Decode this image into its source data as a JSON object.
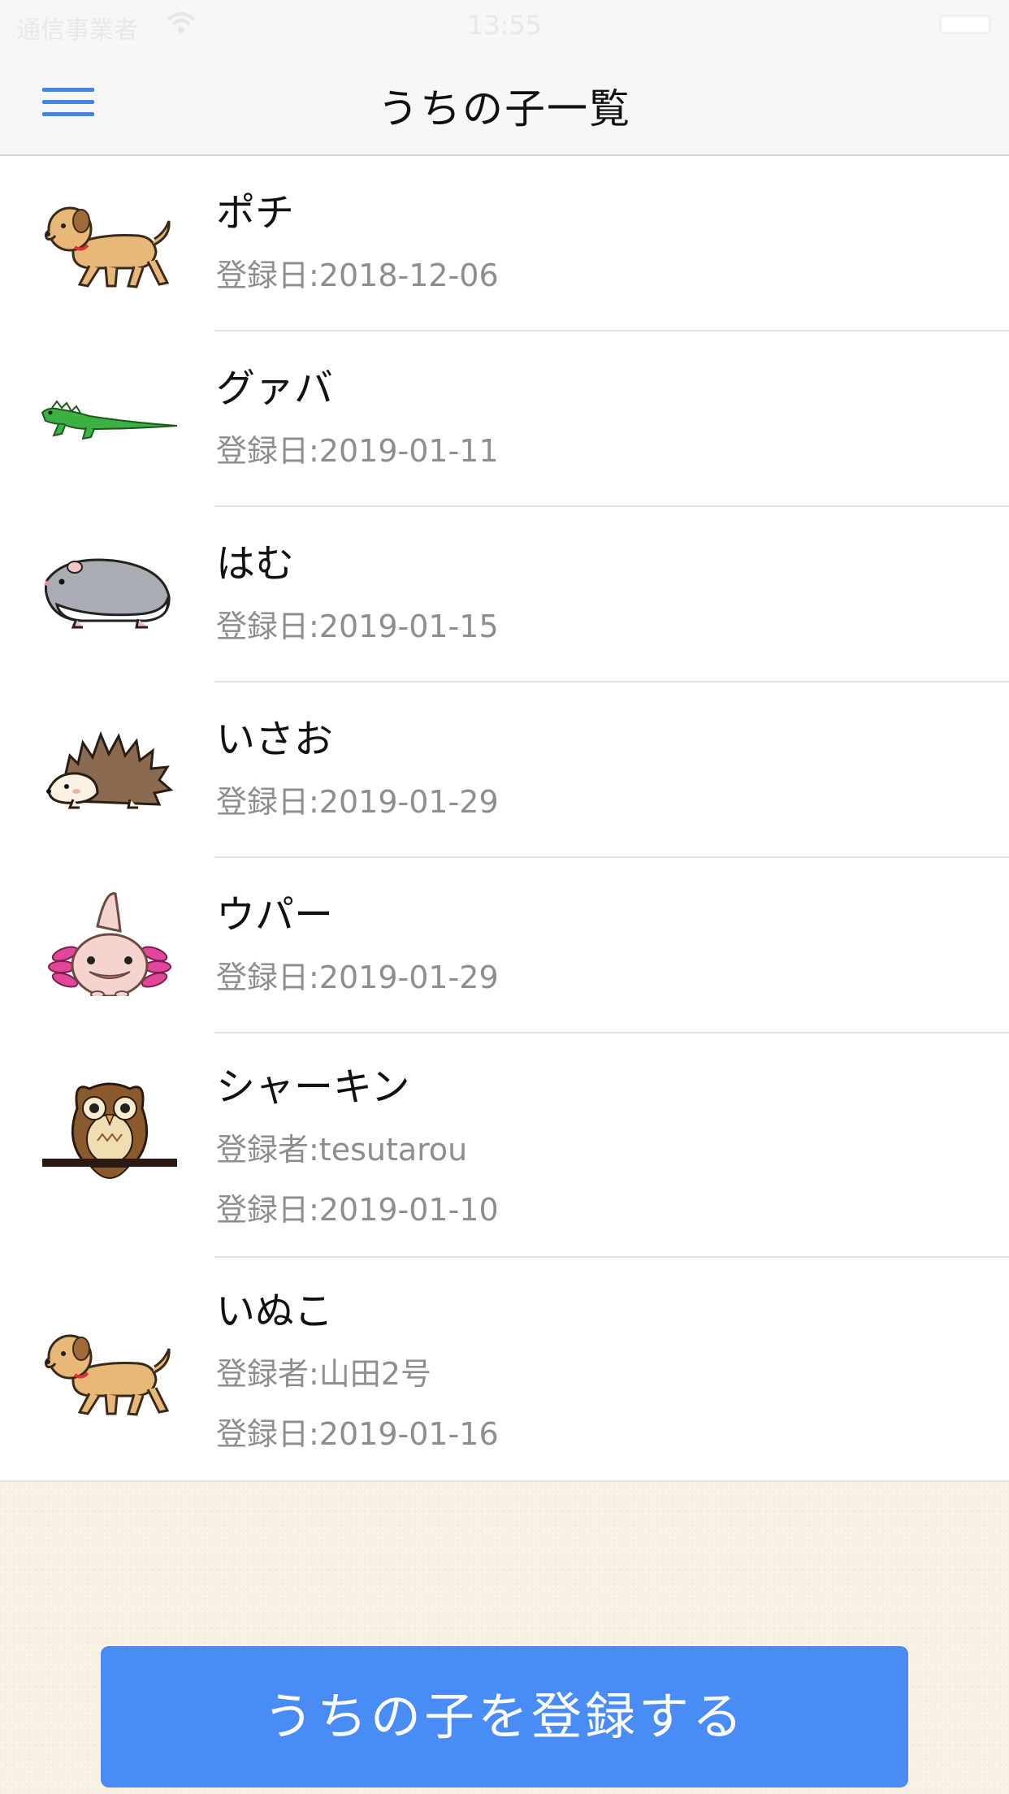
{
  "status_bar": {
    "carrier": "通信事業者",
    "time": "13:55"
  },
  "nav": {
    "title": "うちの子一覧"
  },
  "pets": [
    {
      "name": "ポチ",
      "icon": "dog-icon",
      "date": "登録日:2018-12-06"
    },
    {
      "name": "グァバ",
      "icon": "iguana-icon",
      "date": "登録日:2019-01-11"
    },
    {
      "name": "はむ",
      "icon": "hamster-icon",
      "date": "登録日:2019-01-15"
    },
    {
      "name": "いさお",
      "icon": "hedgehog-icon",
      "date": "登録日:2019-01-29"
    },
    {
      "name": "ウパー",
      "icon": "axolotl-icon",
      "date": "登録日:2019-01-29"
    },
    {
      "name": "シャーキン",
      "icon": "owl-icon",
      "owner": "登録者:tesutarou",
      "date": "登録日:2019-01-10"
    },
    {
      "name": "いぬこ",
      "icon": "dog-icon",
      "owner": "登録者:山田2号",
      "date": "登録日:2019-01-16"
    }
  ],
  "footer": {
    "register_label": "うちの子を登録する"
  },
  "colors": {
    "accent": "#4a8cf7",
    "menu": "#3f86e8",
    "subtext": "#8e8e8e",
    "footer_bg": "#f8f1e3"
  }
}
